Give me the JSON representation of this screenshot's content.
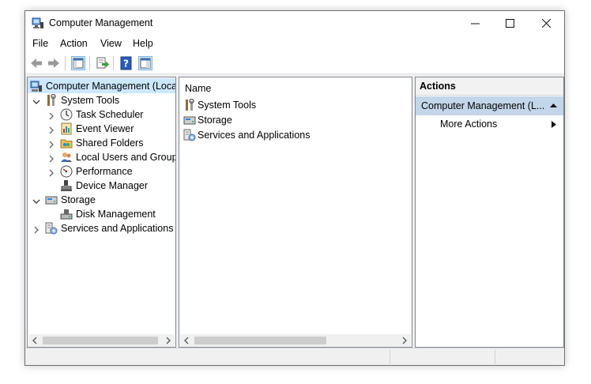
{
  "window": {
    "title": "Computer Management"
  },
  "window_controls": [
    "minimize",
    "maximize",
    "close"
  ],
  "menu": [
    "File",
    "Action",
    "View",
    "Help"
  ],
  "toolbar": {
    "buttons": [
      "back-icon",
      "forward-icon",
      "show-hide-console-tree-icon",
      "export-list-icon",
      "help-icon",
      "show-hide-action-pane-icon"
    ]
  },
  "tree": {
    "root": "Computer Management (Local)",
    "system_tools": "System Tools",
    "task_scheduler": "Task Scheduler",
    "event_viewer": "Event Viewer",
    "shared_folders": "Shared Folders",
    "local_users": "Local Users and Groups",
    "performance": "Performance",
    "device_manager": "Device Manager",
    "storage": "Storage",
    "disk_management": "Disk Management",
    "services_apps": "Services and Applications"
  },
  "list": {
    "header": "Name",
    "items": [
      "System Tools",
      "Storage",
      "Services and Applications"
    ]
  },
  "actions": {
    "header": "Actions",
    "section": "Computer Management (L...",
    "more_actions": "More Actions"
  },
  "colors": {
    "selection": "#cce8ff",
    "actions_section": "#c3d6ea",
    "accent": "#0078d7"
  }
}
